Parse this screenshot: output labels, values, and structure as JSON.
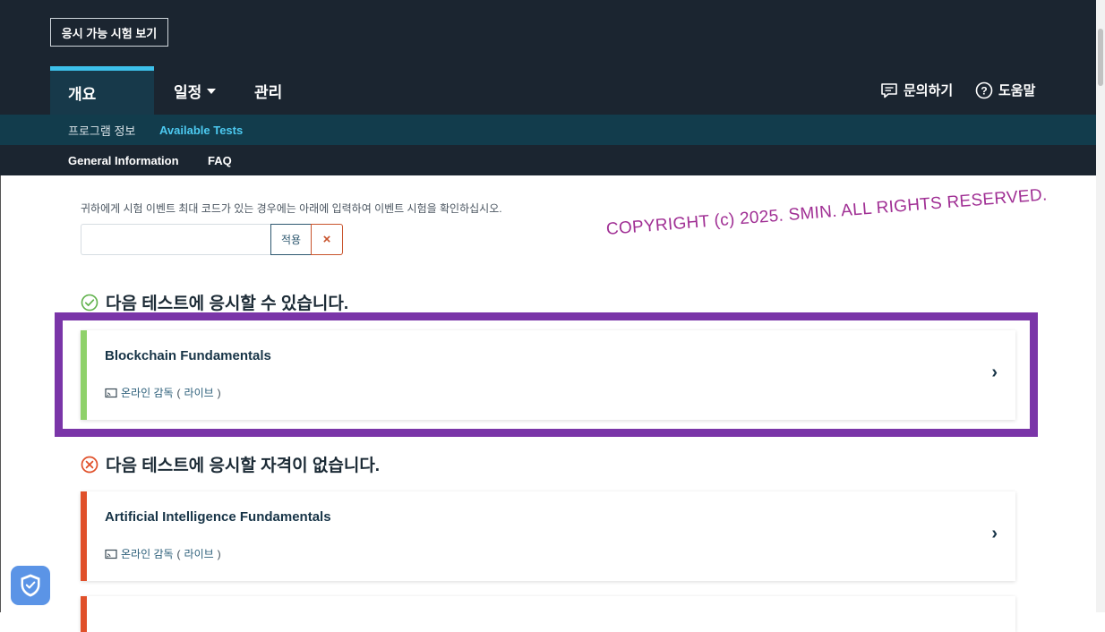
{
  "header": {
    "view_tests_button": "응시 가능 시험 보기",
    "tabs": [
      {
        "label": "개요",
        "active": true
      },
      {
        "label": "일정",
        "has_dropdown": true
      },
      {
        "label": "관리"
      }
    ],
    "contact_label": "문의하기",
    "help_label": "도움말",
    "contact_icon": "chat-icon",
    "help_icon": "question-circle-icon"
  },
  "subnav": {
    "row1": [
      {
        "label": "프로그램 정보"
      },
      {
        "label": "Available Tests",
        "active": true
      }
    ],
    "row2": [
      {
        "label": "General Information"
      },
      {
        "label": "FAQ"
      }
    ]
  },
  "event_code": {
    "hint": "귀하에게 시험 이벤트 최대 코드가 있는 경우에는 아래에 입력하여 이벤트 시험을 확인하십시오.",
    "value": "",
    "apply_label": "적용",
    "clear_label": "×"
  },
  "watermark": "COPYRIGHT (c) 2025. SMIN.  ALL RIGHTS RESERVED.",
  "eligible_section": {
    "heading": "다음 테스트에 응시할 수 있습니다.",
    "icon": "check-circle-icon",
    "tests": [
      {
        "title": "Blockchain Fundamentals",
        "delivery": "온라인 감독",
        "paren_open": "(",
        "delivery_mode": "라이브",
        "paren_close": ")"
      }
    ]
  },
  "ineligible_section": {
    "heading": "다음 테스트에 응시할 자격이 없습니다.",
    "icon": "x-circle-icon",
    "tests": [
      {
        "title": "Artificial Intelligence Fundamentals",
        "delivery": "온라인 감독",
        "paren_open": "(",
        "delivery_mode": "라이브",
        "paren_close": ")"
      }
    ]
  },
  "colors": {
    "header_bg": "#1b2530",
    "subnav_bg": "#123c4c",
    "accent": "#3dc0ea",
    "eligible": "#8fd16a",
    "ineligible": "#e0502a",
    "highlight": "#7a35a8",
    "watermark": "#a02f94"
  },
  "privacy_badge_icon": "shield-check-icon"
}
